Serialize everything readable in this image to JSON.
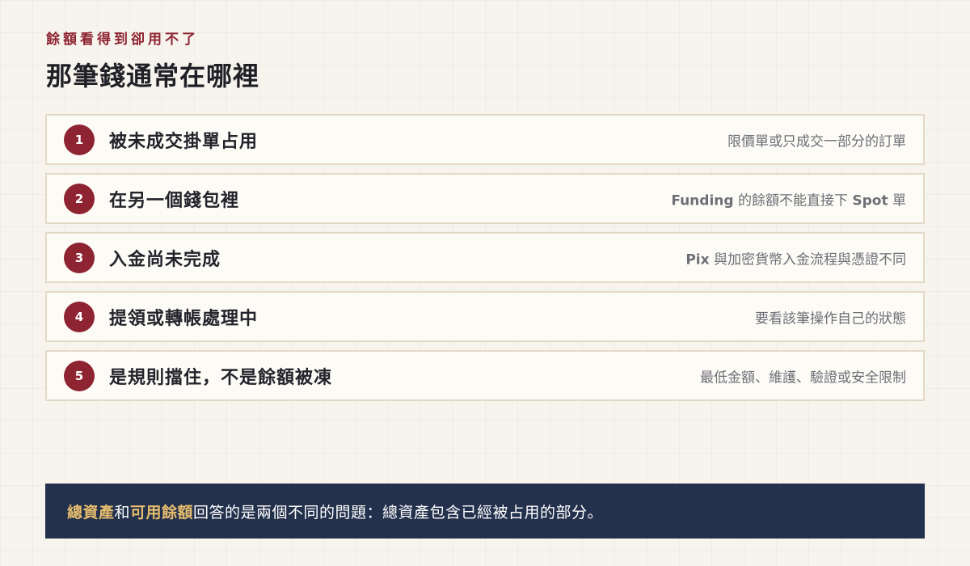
{
  "header": {
    "eyebrow": "餘額看得到卻用不了",
    "title": "那筆錢通常在哪裡"
  },
  "items": [
    {
      "number": "1",
      "title": "被未成交掛單占用",
      "description": "限價單或只成交一部分的訂單"
    },
    {
      "number": "2",
      "title": "在另一個錢包裡",
      "description_bold_1": "Funding",
      "description_middle": " 的餘額不能直接下 ",
      "description_bold_2": "Spot",
      "description_tail": " 單"
    },
    {
      "number": "3",
      "title": "入金尚未完成",
      "description_bold": "Pix",
      "description_tail": " 與加密貨幣入金流程與憑證不同"
    },
    {
      "number": "4",
      "title": "提領或轉帳處理中",
      "description": "要看該筆操作自己的狀態"
    },
    {
      "number": "5",
      "title": "是規則擋住，不是餘額被凍",
      "description": "最低金額、維護、驗證或安全限制"
    }
  ],
  "note": {
    "highlight_1": "總資產",
    "connector": "和",
    "highlight_2": "可用餘額",
    "text": "回答的是兩個不同的問題：總資產包含已經被占用的部分。"
  },
  "colors": {
    "accent": "#8e2432",
    "note_background": "#24314d",
    "highlight": "#e6bd6d",
    "card_background": "#fdfbf6",
    "card_border": "#e3d9c8",
    "page_background": "#f7f4ee"
  }
}
